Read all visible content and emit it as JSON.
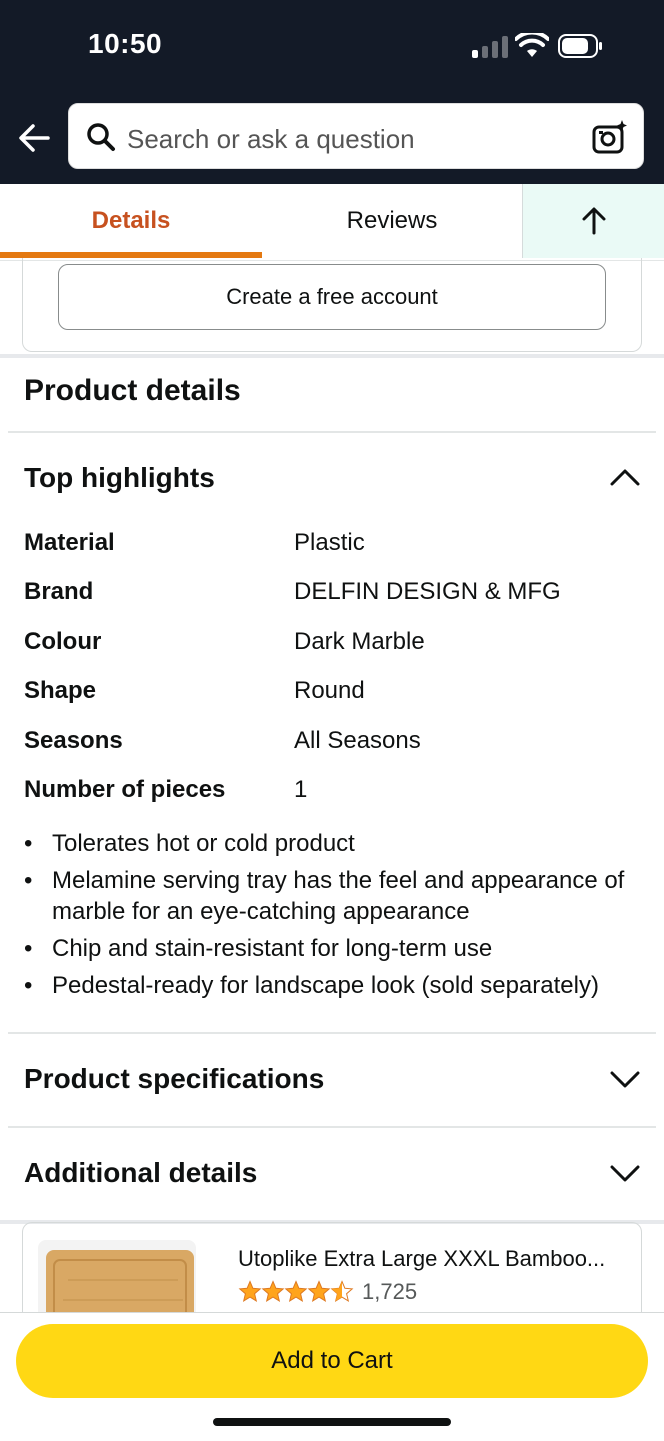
{
  "status_bar": {
    "time": "10:50"
  },
  "header": {
    "search_placeholder": "Search or ask a question"
  },
  "tabs": [
    {
      "label": "Details",
      "active": true
    },
    {
      "label": "Reviews",
      "active": false
    }
  ],
  "account": {
    "create_label": "Create a free account"
  },
  "product_details": {
    "title": "Product details",
    "top_highlights": {
      "title": "Top highlights",
      "rows": [
        {
          "key": "Material",
          "value": "Plastic"
        },
        {
          "key": "Brand",
          "value": "DELFIN DESIGN & MFG"
        },
        {
          "key": "Colour",
          "value": "Dark Marble"
        },
        {
          "key": "Shape",
          "value": "Round"
        },
        {
          "key": "Seasons",
          "value": "All Seasons"
        },
        {
          "key": "Number of pieces",
          "value": "1"
        }
      ],
      "bullets": [
        "Tolerates hot or cold product",
        "Melamine serving tray has the feel and appearance of marble for an eye-catching appearance",
        "Chip and stain-resistant for long-term use",
        "Pedestal-ready for landscape look (sold separately)"
      ]
    },
    "specifications_title": "Product specifications",
    "additional_title": "Additional details"
  },
  "related_product": {
    "title": "Utoplike Extra Large XXXL Bamboo...",
    "rating": 4.5,
    "rating_count": "1,725"
  },
  "bottom": {
    "add_to_cart": "Add to Cart"
  },
  "colors": {
    "header_bg": "#131a27",
    "accent_orange": "#c7511f",
    "cart_yellow": "#ffd814",
    "star": "#ffa41c"
  }
}
